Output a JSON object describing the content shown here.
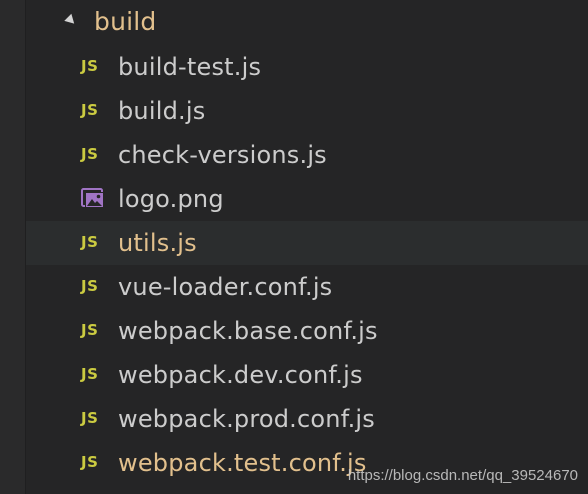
{
  "folder": {
    "name": "build",
    "expanded_icon": "chevron-down-icon"
  },
  "files": [
    {
      "name": "build-test.js",
      "icon": "JS",
      "type": "js",
      "modified": false,
      "selected": false
    },
    {
      "name": "build.js",
      "icon": "JS",
      "type": "js",
      "modified": false,
      "selected": false
    },
    {
      "name": "check-versions.js",
      "icon": "JS",
      "type": "js",
      "modified": false,
      "selected": false
    },
    {
      "name": "logo.png",
      "icon": "image",
      "type": "image",
      "modified": false,
      "selected": false
    },
    {
      "name": "utils.js",
      "icon": "JS",
      "type": "js",
      "modified": true,
      "selected": true
    },
    {
      "name": "vue-loader.conf.js",
      "icon": "JS",
      "type": "js",
      "modified": false,
      "selected": false
    },
    {
      "name": "webpack.base.conf.js",
      "icon": "JS",
      "type": "js",
      "modified": false,
      "selected": false
    },
    {
      "name": "webpack.dev.conf.js",
      "icon": "JS",
      "type": "js",
      "modified": false,
      "selected": false
    },
    {
      "name": "webpack.prod.conf.js",
      "icon": "JS",
      "type": "js",
      "modified": false,
      "selected": false
    },
    {
      "name": "webpack.test.conf.js",
      "icon": "JS",
      "type": "js",
      "modified": true,
      "selected": false
    }
  ],
  "watermark": "https://blog.csdn.net/qq_39524670",
  "colors": {
    "background": "#252526",
    "js_icon": "#cbcb41",
    "image_icon": "#a074c4",
    "modified_text": "#e2c08d",
    "default_text": "#cccccc",
    "selected_row": "#2b2d2e"
  }
}
